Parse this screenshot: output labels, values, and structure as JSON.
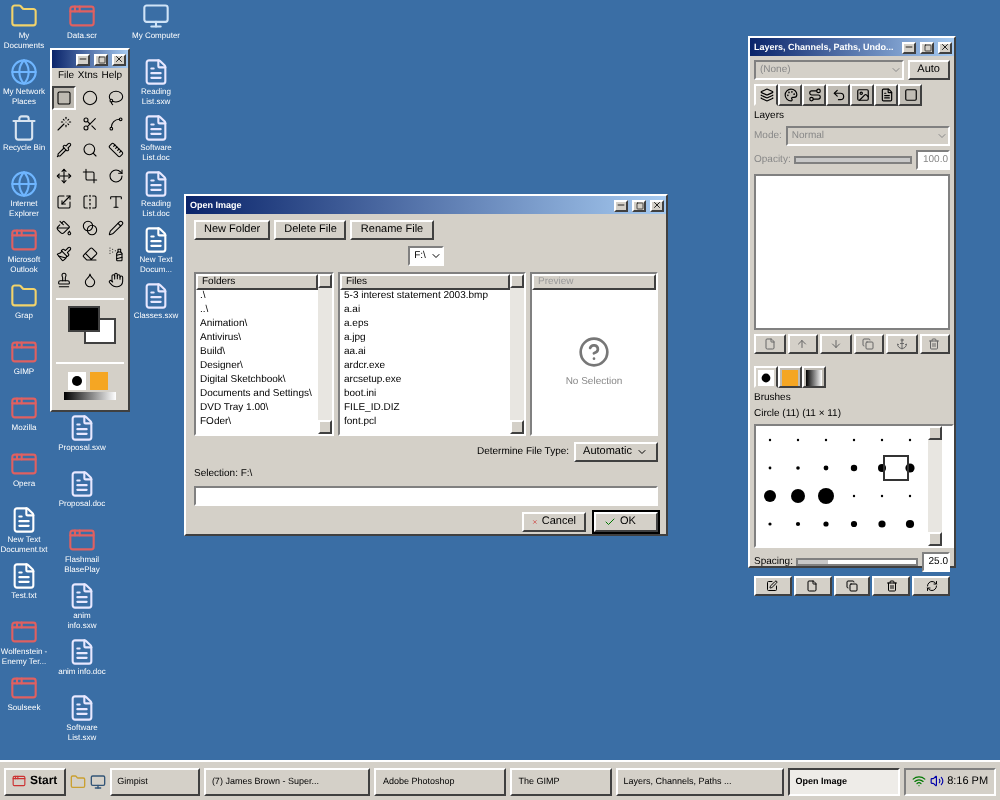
{
  "desktop_icons": {
    "left": [
      {
        "label": "My Documents",
        "kind": "folder"
      },
      {
        "label": "My Network Places",
        "kind": "globe"
      },
      {
        "label": "Recycle Bin",
        "kind": "bin"
      },
      {
        "label": "Internet Explorer",
        "kind": "globe"
      },
      {
        "label": "Microsoft Outlook",
        "kind": "app"
      },
      {
        "label": "Grap",
        "kind": "folder"
      },
      {
        "label": "GIMP",
        "kind": "app"
      },
      {
        "label": "Mozilla",
        "kind": "app"
      },
      {
        "label": "Opera",
        "kind": "app"
      },
      {
        "label": "New Text Document.txt",
        "kind": "text"
      },
      {
        "label": "Test.txt",
        "kind": "text"
      },
      {
        "label": "Wolfenstein - Enemy Ter...",
        "kind": "app"
      },
      {
        "label": "Soulseek",
        "kind": "app"
      }
    ],
    "middle_top": [
      {
        "label": "Data.scr",
        "kind": "app"
      }
    ],
    "middle_bottom": [
      {
        "label": "Proposal.sxw",
        "kind": "doc"
      },
      {
        "label": "Proposal.doc",
        "kind": "doc"
      },
      {
        "label": "Flashmail BlasePlay",
        "kind": "app"
      },
      {
        "label": "anim info.sxw",
        "kind": "doc"
      },
      {
        "label": "anim info.doc",
        "kind": "doc"
      },
      {
        "label": "Software List.sxw",
        "kind": "doc"
      }
    ],
    "right": [
      {
        "label": "My Computer",
        "kind": "computer"
      },
      {
        "label": "Reading List.sxw",
        "kind": "doc"
      },
      {
        "label": "Software List.doc",
        "kind": "doc"
      },
      {
        "label": "Reading List.doc",
        "kind": "doc"
      },
      {
        "label": "New Text Docum...",
        "kind": "text"
      },
      {
        "label": "Classes.sxw",
        "kind": "doc"
      }
    ]
  },
  "toolbox": {
    "menu": [
      "File",
      "Xtns",
      "Help"
    ],
    "tools": [
      {
        "selected": true
      },
      {
        "selected": false
      },
      {
        "selected": false
      },
      {
        "selected": false
      },
      {
        "selected": false
      },
      {
        "selected": false
      },
      {
        "selected": false
      },
      {
        "selected": false
      },
      {
        "selected": false
      },
      {
        "selected": false
      },
      {
        "selected": false
      },
      {
        "selected": false
      },
      {
        "selected": false
      },
      {
        "selected": false
      },
      {
        "selected": false
      },
      {
        "selected": false
      },
      {
        "selected": false
      },
      {
        "selected": false
      },
      {
        "selected": false
      },
      {
        "selected": false
      },
      {
        "selected": false
      },
      {
        "selected": false
      },
      {
        "selected": false
      },
      {
        "selected": false
      }
    ]
  },
  "open_dialog": {
    "title": "Open Image",
    "buttons": [
      "New Folder",
      "Delete File",
      "Rename File"
    ],
    "drive": "F:\\",
    "folders_header": "Folders",
    "folders": [
      ".\\",
      "..\\",
      "Animation\\",
      "Antivirus\\",
      "Build\\",
      "Designer\\",
      "Digital Sketchbook\\",
      "Documents and Settings\\",
      "DVD Tray 1.00\\",
      "FOder\\"
    ],
    "files_header": "Files",
    "files": [
      "5-3 interest statement 2003.bmp",
      "a.ai",
      "a.eps",
      "a.jpg",
      "aa.ai",
      "ardcr.exe",
      "arcsetup.exe",
      "boot.ini",
      "FILE_ID.DIZ",
      "font.pcl"
    ],
    "preview_header": "Preview",
    "preview_text": "No Selection",
    "file_type_label": "Determine File Type:",
    "file_type": "Automatic",
    "selection_label": "Selection: F:\\",
    "cancel": "Cancel",
    "ok": "OK"
  },
  "layers_dock": {
    "title": "Layers, Channels, Paths, Undo...",
    "image": "(None)",
    "auto": "Auto",
    "tabs": [
      {
        "selected": true
      },
      {
        "selected": false
      },
      {
        "selected": false
      },
      {
        "selected": false
      },
      {
        "selected": false
      },
      {
        "selected": false
      },
      {
        "selected": false
      }
    ],
    "layers_label": "Layers",
    "mode_label": "Mode:",
    "mode": "Normal",
    "opacity_label": "Opacity:",
    "opacity": {
      "level": 1,
      "reading": "100.0"
    },
    "brush_tabs": [
      {
        "selected": true
      },
      {
        "selected": false
      },
      {
        "selected": false
      }
    ],
    "brushes_label": "Brushes",
    "brush_name": "Circle (11) (11 × 11)",
    "spacing_label": "Spacing:",
    "spacing": {
      "level": 0.25,
      "reading": "25.0"
    }
  },
  "taskbar": {
    "start": "Start",
    "tasks": [
      {
        "label": "Gimpist",
        "selected": false
      },
      {
        "label": "(7) James Brown - Super...",
        "selected": false
      },
      {
        "label": "Adobe Photoshop",
        "selected": false
      },
      {
        "label": "The GIMP",
        "selected": false
      },
      {
        "label": "Layers, Channels, Paths ...",
        "selected": false
      },
      {
        "label": "Open Image",
        "selected": true
      }
    ],
    "clock": "8:16 PM"
  }
}
